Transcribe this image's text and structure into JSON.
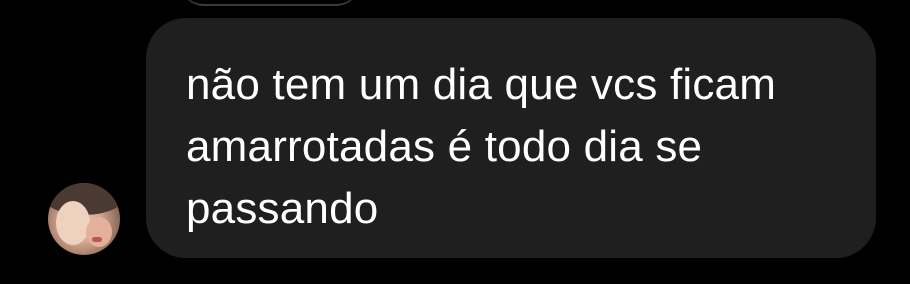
{
  "message": {
    "text": "não tem um dia que vcs ficam amarrotadas é todo dia se passando"
  },
  "avatar": {
    "icon": "profile-photo"
  },
  "colors": {
    "background": "#000000",
    "bubble": "#1f1f1f",
    "text": "#ffffff"
  }
}
